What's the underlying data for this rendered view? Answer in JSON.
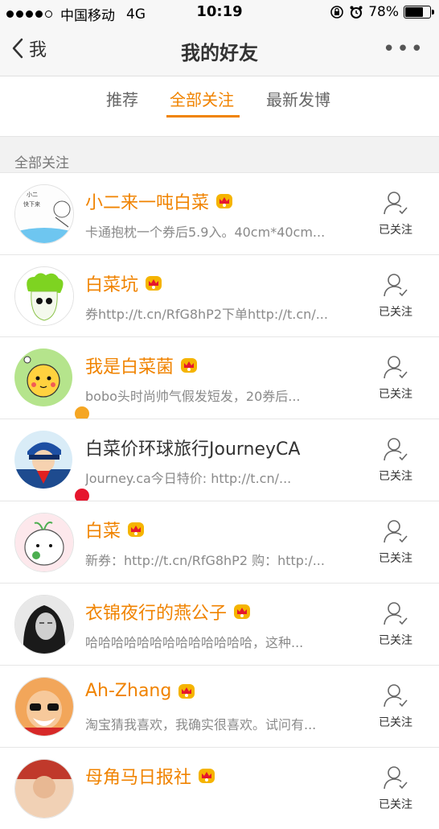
{
  "status": {
    "carrier": "中国移动",
    "network": "4G",
    "time": "10:19",
    "battery": "78%"
  },
  "nav": {
    "back_label": "我",
    "title": "我的好友",
    "more": "•••"
  },
  "tabs": [
    "推荐",
    "全部关注",
    "最新发博"
  ],
  "section_title": "全部关注",
  "follow_label": "已关注",
  "users": [
    {
      "name": "小二来一吨白菜",
      "desc": "卡通抱枕一个券后5.9入。40cm*40cm...",
      "vip": true
    },
    {
      "name": "白菜坑",
      "desc": "券http://t.cn/RfG8hP2下单http://t.cn/...",
      "vip": true
    },
    {
      "name": "我是白菜菌",
      "desc": "bobo头时尚帅气假发短发，20券后...",
      "vip": true
    },
    {
      "name": "白菜价环球旅行JourneyCA",
      "desc": "Journey.ca今日特价: http://t.cn/...",
      "vip": false
    },
    {
      "name": "白菜",
      "desc": "新券：http://t.cn/RfG8hP2 购：http:/...",
      "vip": true
    },
    {
      "name": "衣锦夜行的燕公子",
      "desc": "哈哈哈哈哈哈哈哈哈哈哈哈哈，这种...",
      "vip": true
    },
    {
      "name": "Ah-Zhang",
      "desc": "淘宝猜我喜欢，我确实很喜欢。试问有...",
      "vip": true
    },
    {
      "name": "母角马日报社",
      "desc": "",
      "vip": true
    }
  ],
  "colors": {
    "accent": "#f08300",
    "badge_gold": "#f5a623",
    "badge_red": "#e6162d"
  }
}
